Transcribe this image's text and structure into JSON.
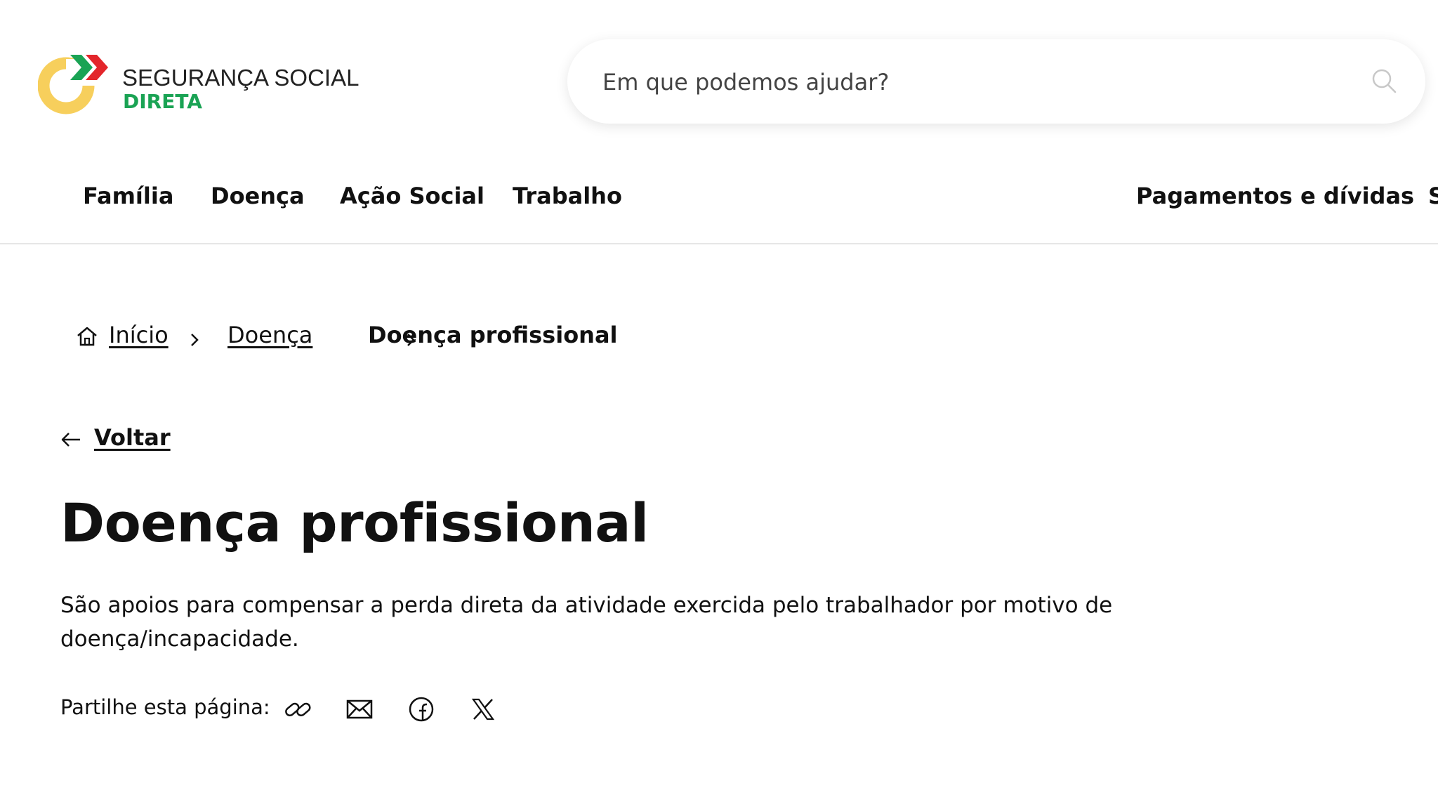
{
  "brand": {
    "line1": "SEGURANÇA SOCIAL",
    "line2": "DIRETA",
    "colors": {
      "green": "#1aa354",
      "red": "#e3262b",
      "yellow": "#f7cf5c"
    }
  },
  "search": {
    "placeholder": "Em que podemos ajudar?",
    "value": "",
    "icon": "search-icon"
  },
  "nav": {
    "items": [
      {
        "label": "Família"
      },
      {
        "label": "Doença"
      },
      {
        "label": "Ação Social"
      },
      {
        "label": "Trabalho"
      },
      {
        "label": "Pagamentos e dívidas"
      },
      {
        "label": "S"
      }
    ]
  },
  "breadcrumb": {
    "home_icon": "home-icon",
    "items": [
      {
        "label": "Início"
      },
      {
        "label": "Doença"
      },
      {
        "label": "Doença profissional"
      }
    ]
  },
  "back": {
    "label": "Voltar",
    "icon": "arrow-left-icon"
  },
  "page": {
    "title": "Doença profissional",
    "description": "São apoios para compensar a perda direta da atividade exercida pelo trabalhador por motivo de doença/incapacidade."
  },
  "share": {
    "label": "Partilhe esta página:",
    "icons": [
      "link-icon",
      "mail-icon",
      "facebook-icon",
      "x-icon"
    ]
  }
}
